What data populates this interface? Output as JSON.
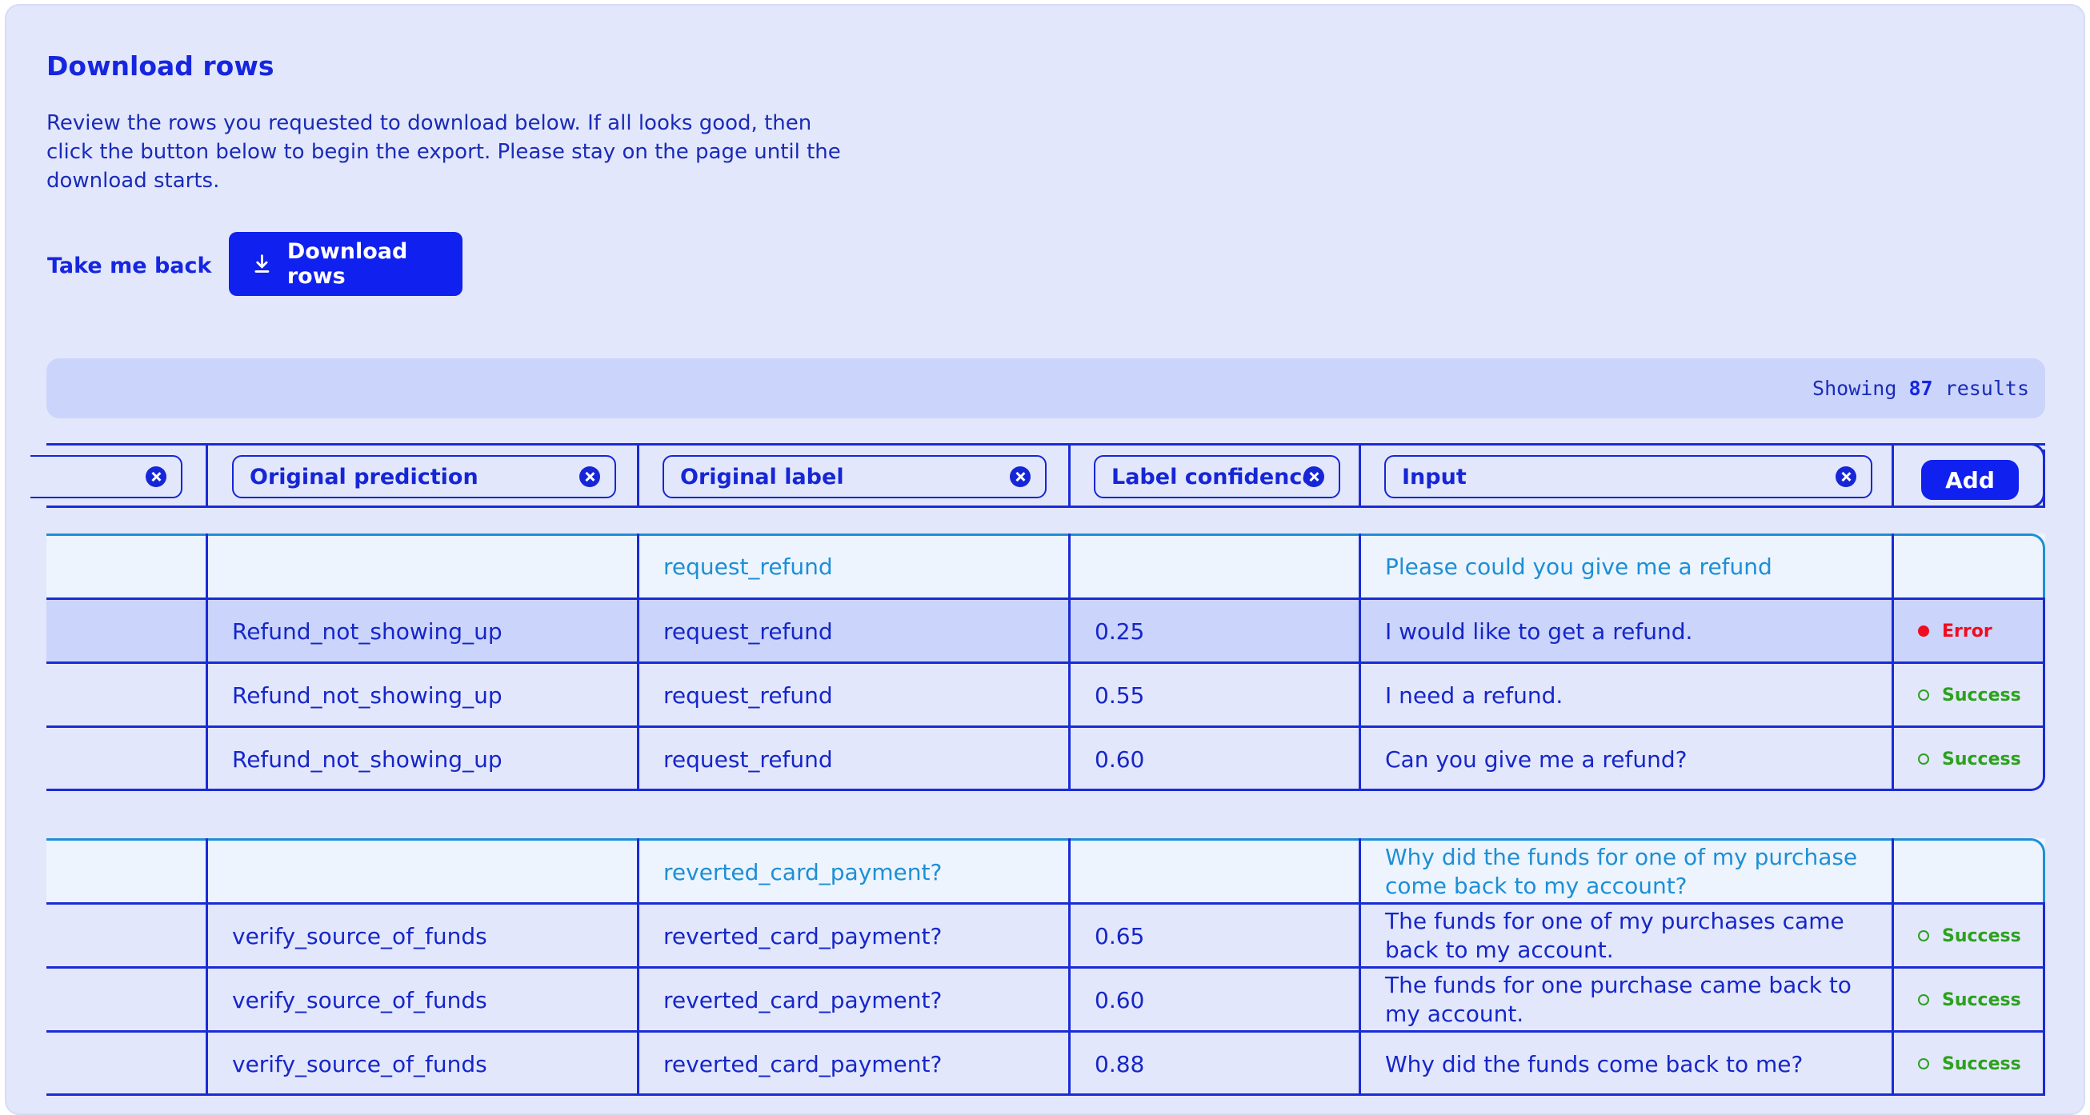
{
  "page": {
    "title": "Download rows",
    "description": "Review the rows you requested to download below. If all looks good, then click the button below to begin the export. Please stay on the page until the download starts.",
    "back_label": "Take me back",
    "download_label": "Download rows"
  },
  "results": {
    "prefix": "Showing",
    "count": "87",
    "suffix": "results"
  },
  "columns": [
    {
      "label": "Original prediction"
    },
    {
      "label": "Original label"
    },
    {
      "label": "Label confidence"
    },
    {
      "label": "Input"
    }
  ],
  "add_label": "Add",
  "groups": [
    {
      "reference": {
        "label": "request_refund",
        "input": "Please could you give me a refund"
      },
      "rows": [
        {
          "prediction": "Refund_not_showing_up",
          "label": "request_refund",
          "confidence": "0.25",
          "input": "I would like to get a refund.",
          "status": "Error",
          "highlight": true
        },
        {
          "prediction": "Refund_not_showing_up",
          "label": "request_refund",
          "confidence": "0.55",
          "input": "I need a refund.",
          "status": "Success"
        },
        {
          "prediction": "Refund_not_showing_up",
          "label": "request_refund",
          "confidence": "0.60",
          "input": "Can you give me a refund?",
          "status": "Success"
        }
      ]
    },
    {
      "reference": {
        "label": "reverted_card_payment?",
        "input": "Why did the funds for one of my purchase come back to my account?"
      },
      "rows": [
        {
          "prediction": "verify_source_of_funds",
          "label": "reverted_card_payment?",
          "confidence": "0.65",
          "input": "The funds for one of my purchases came back to my account.",
          "status": "Success"
        },
        {
          "prediction": "verify_source_of_funds",
          "label": "reverted_card_payment?",
          "confidence": "0.60",
          "input": "The funds for one purchase came back to my account.",
          "status": "Success"
        },
        {
          "prediction": "verify_source_of_funds",
          "label": "reverted_card_payment?",
          "confidence": "0.88",
          "input": "Why did the funds come back to me?",
          "status": "Success"
        }
      ]
    }
  ]
}
